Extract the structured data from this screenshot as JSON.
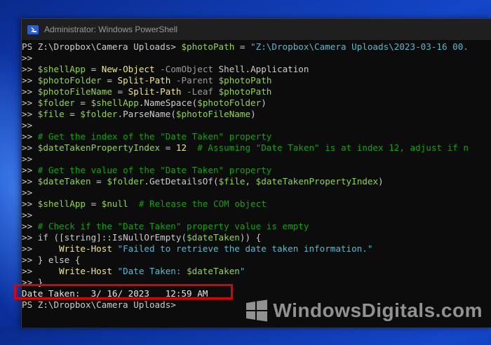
{
  "window": {
    "title": "Administrator: Windows PowerShell"
  },
  "console": {
    "lines": [
      [
        {
          "t": "PS Z:\\Dropbox\\Camera Uploads> ",
          "c": "c-dim"
        },
        {
          "t": "$photoPath",
          "c": "c-var"
        },
        {
          "t": " = ",
          "c": "c-dim"
        },
        {
          "t": "\"Z:\\Dropbox\\Camera Uploads\\2023-03-16 00.",
          "c": "c-str"
        }
      ],
      [
        {
          "t": ">>",
          "c": "c-dim"
        }
      ],
      [
        {
          "t": ">> ",
          "c": "c-dim"
        },
        {
          "t": "$shellApp",
          "c": "c-var"
        },
        {
          "t": " = ",
          "c": "c-dim"
        },
        {
          "t": "New-Object",
          "c": "c-cmd"
        },
        {
          "t": " -ComObject ",
          "c": "c-param"
        },
        {
          "t": "Shell.Application",
          "c": "c-dim"
        }
      ],
      [
        {
          "t": ">> ",
          "c": "c-dim"
        },
        {
          "t": "$photoFolder",
          "c": "c-var"
        },
        {
          "t": " = ",
          "c": "c-dim"
        },
        {
          "t": "Split-Path",
          "c": "c-cmd"
        },
        {
          "t": " -Parent ",
          "c": "c-param"
        },
        {
          "t": "$photoPath",
          "c": "c-var"
        }
      ],
      [
        {
          "t": ">> ",
          "c": "c-dim"
        },
        {
          "t": "$photoFileName",
          "c": "c-var"
        },
        {
          "t": " = ",
          "c": "c-dim"
        },
        {
          "t": "Split-Path",
          "c": "c-cmd"
        },
        {
          "t": " -Leaf ",
          "c": "c-param"
        },
        {
          "t": "$photoPath",
          "c": "c-var"
        }
      ],
      [
        {
          "t": ">> ",
          "c": "c-dim"
        },
        {
          "t": "$folder",
          "c": "c-var"
        },
        {
          "t": " = ",
          "c": "c-dim"
        },
        {
          "t": "$shellApp",
          "c": "c-var"
        },
        {
          "t": ".NameSpace(",
          "c": "c-dim"
        },
        {
          "t": "$photoFolder",
          "c": "c-var"
        },
        {
          "t": ")",
          "c": "c-dim"
        }
      ],
      [
        {
          "t": ">> ",
          "c": "c-dim"
        },
        {
          "t": "$file",
          "c": "c-var"
        },
        {
          "t": " = ",
          "c": "c-dim"
        },
        {
          "t": "$folder",
          "c": "c-var"
        },
        {
          "t": ".ParseName(",
          "c": "c-dim"
        },
        {
          "t": "$photoFileName",
          "c": "c-var"
        },
        {
          "t": ")",
          "c": "c-dim"
        }
      ],
      [
        {
          "t": ">>",
          "c": "c-dim"
        }
      ],
      [
        {
          "t": ">> ",
          "c": "c-dim"
        },
        {
          "t": "# Get the index of the \"Date Taken\" property",
          "c": "c-com"
        }
      ],
      [
        {
          "t": ">> ",
          "c": "c-dim"
        },
        {
          "t": "$dateTakenPropertyIndex",
          "c": "c-var"
        },
        {
          "t": " = ",
          "c": "c-dim"
        },
        {
          "t": "12",
          "c": "c-num"
        },
        {
          "t": "  # Assuming \"Date Taken\" is at index 12, adjust if n",
          "c": "c-com"
        }
      ],
      [
        {
          "t": ">>",
          "c": "c-dim"
        }
      ],
      [
        {
          "t": ">> ",
          "c": "c-dim"
        },
        {
          "t": "# Get the value of the \"Date Taken\" property",
          "c": "c-com"
        }
      ],
      [
        {
          "t": ">> ",
          "c": "c-dim"
        },
        {
          "t": "$dateTaken",
          "c": "c-var"
        },
        {
          "t": " = ",
          "c": "c-dim"
        },
        {
          "t": "$folder",
          "c": "c-var"
        },
        {
          "t": ".GetDetailsOf(",
          "c": "c-dim"
        },
        {
          "t": "$file",
          "c": "c-var"
        },
        {
          "t": ", ",
          "c": "c-dim"
        },
        {
          "t": "$dateTakenPropertyIndex",
          "c": "c-var"
        },
        {
          "t": ")",
          "c": "c-dim"
        }
      ],
      [
        {
          "t": ">>",
          "c": "c-dim"
        }
      ],
      [
        {
          "t": ">> ",
          "c": "c-dim"
        },
        {
          "t": "$shellApp",
          "c": "c-var"
        },
        {
          "t": " = ",
          "c": "c-dim"
        },
        {
          "t": "$null",
          "c": "c-var"
        },
        {
          "t": "  # Release the COM object",
          "c": "c-com"
        }
      ],
      [
        {
          "t": ">>",
          "c": "c-dim"
        }
      ],
      [
        {
          "t": ">> ",
          "c": "c-dim"
        },
        {
          "t": "# Check if the \"Date Taken\" property value is empty",
          "c": "c-com"
        }
      ],
      [
        {
          "t": ">> ",
          "c": "c-dim"
        },
        {
          "t": "if",
          "c": "c-dim"
        },
        {
          "t": " ([string]::IsNullOrEmpty(",
          "c": "c-dim"
        },
        {
          "t": "$dateTaken",
          "c": "c-var"
        },
        {
          "t": ")) {",
          "c": "c-dim"
        }
      ],
      [
        {
          "t": ">>     ",
          "c": "c-dim"
        },
        {
          "t": "Write-Host",
          "c": "c-cmd"
        },
        {
          "t": " \"Failed to retrieve the date taken information.\"",
          "c": "c-str"
        }
      ],
      [
        {
          "t": ">> } else {",
          "c": "c-dim"
        }
      ],
      [
        {
          "t": ">>     ",
          "c": "c-dim"
        },
        {
          "t": "Write-Host",
          "c": "c-cmd"
        },
        {
          "t": " \"Date Taken: ",
          "c": "c-str"
        },
        {
          "t": "$dateTaken",
          "c": "c-var"
        },
        {
          "t": "\"",
          "c": "c-str"
        }
      ],
      [
        {
          "t": ">> }",
          "c": "c-dim"
        }
      ],
      [
        {
          "t": "Date Taken:  3/ 16/ 2023   12:59 AM",
          "c": "c-out"
        }
      ],
      [
        {
          "t": "PS Z:\\Dropbox\\Camera Uploads>",
          "c": "c-dim"
        }
      ]
    ]
  },
  "watermark": {
    "text": "WindowsDigitals.com"
  },
  "colors": {
    "highlight_box": "#e00000",
    "console_bg": "#0c0c0c",
    "variable": "#92d250",
    "string": "#5fb5c8",
    "command": "#f0e68c",
    "comment": "#13a10e"
  }
}
